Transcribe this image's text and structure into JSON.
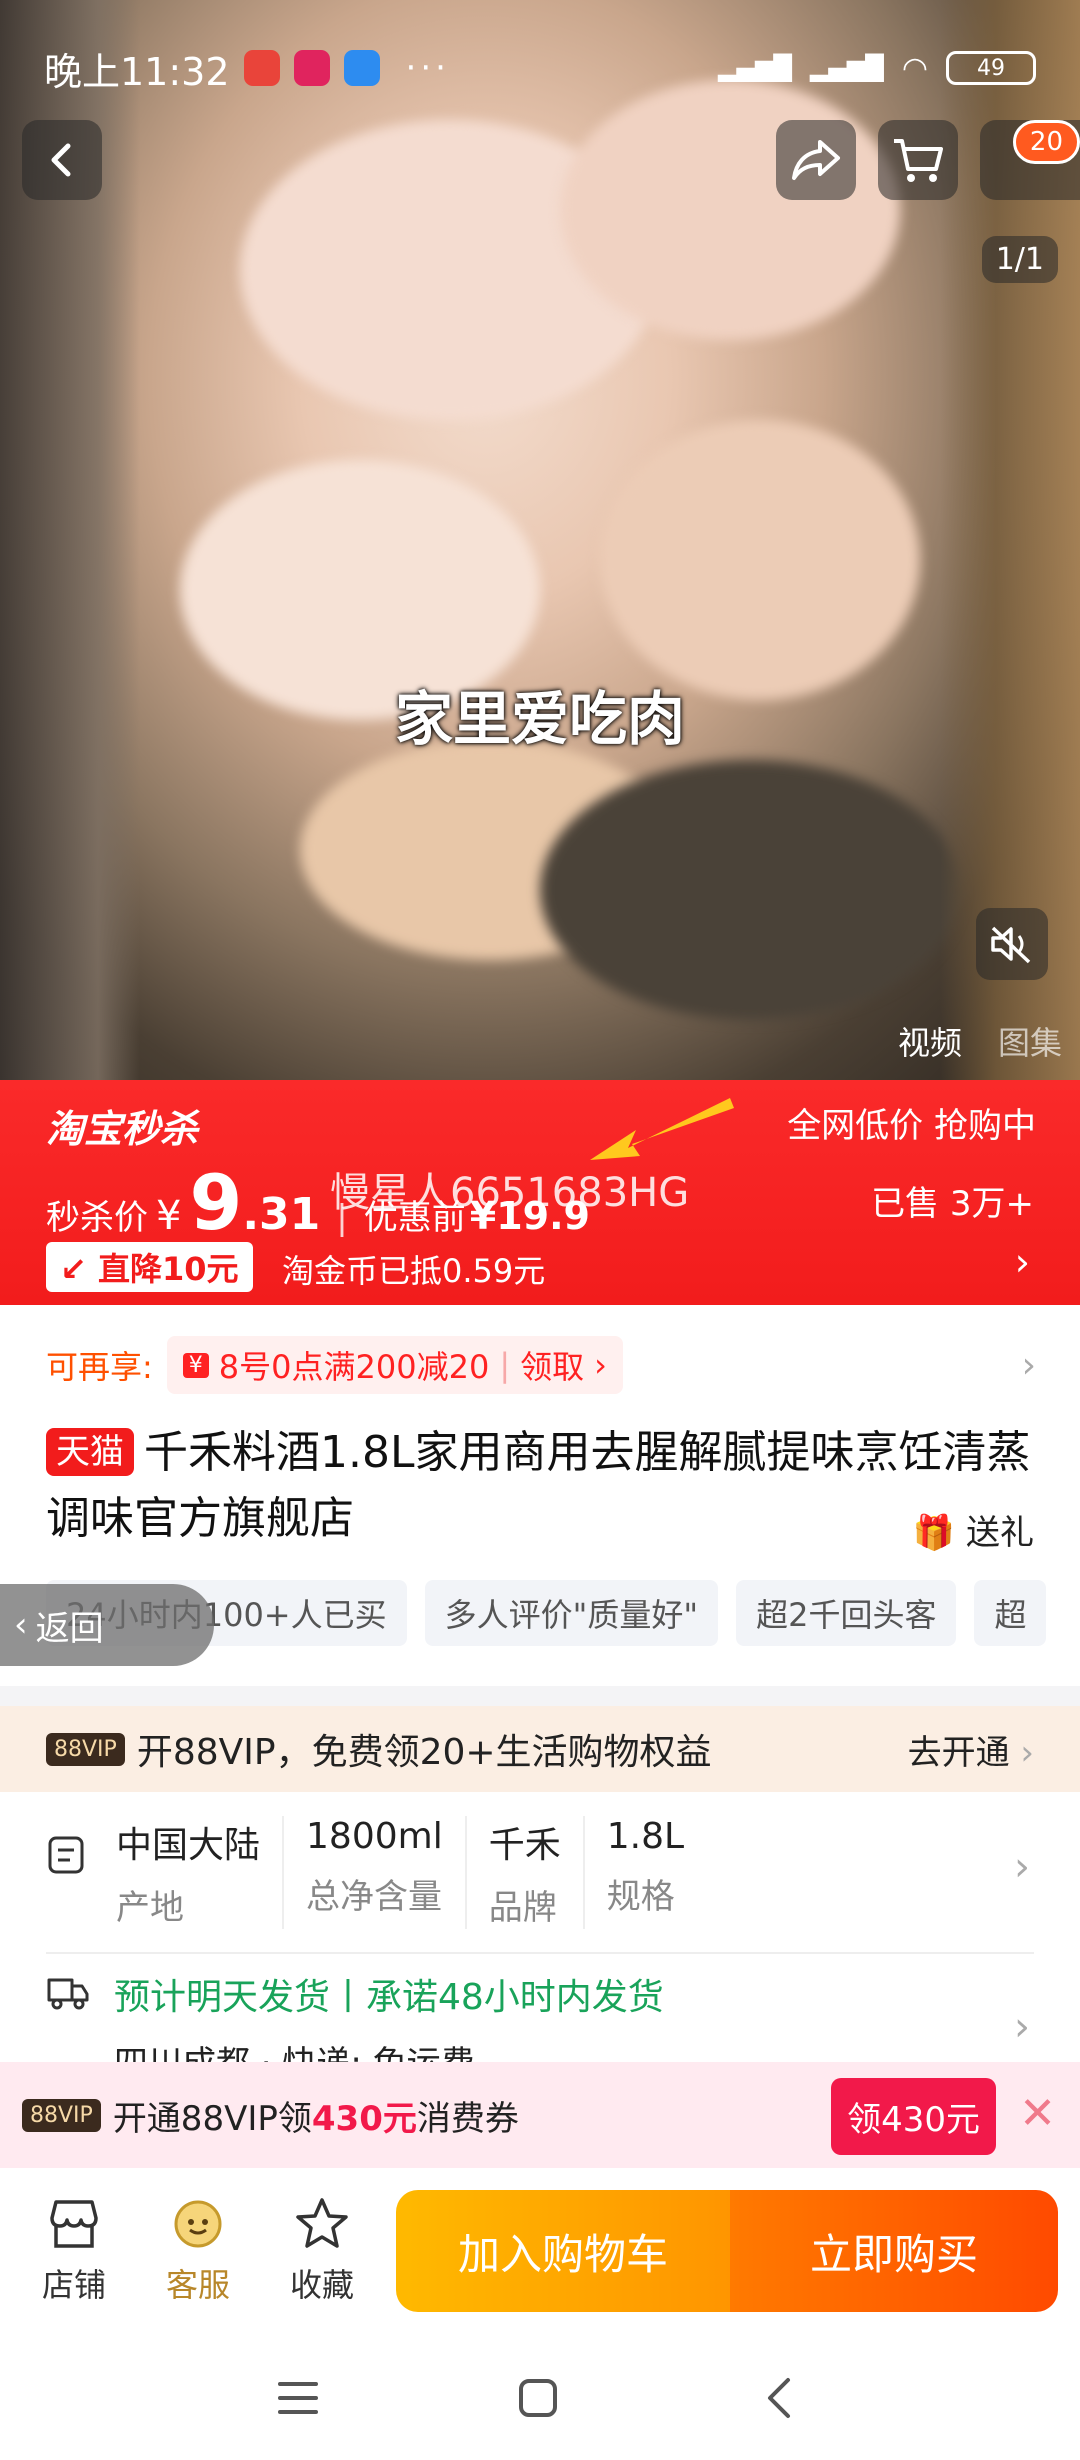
{
  "status_bar": {
    "time": "晚上11:32",
    "battery": "49",
    "more": "···"
  },
  "media": {
    "subtitle": "家里爱吃肉",
    "page_indicator": "1/1",
    "cart_badge": "20",
    "tabs": [
      "视频",
      "图集"
    ]
  },
  "flash_sale": {
    "brand": "淘宝秒杀",
    "tagline": "全网低价 抢购中",
    "price_label": "秒杀价",
    "currency": "¥",
    "price_int": "9",
    "price_dec": ".31",
    "original_label": "优惠前",
    "original_price": "¥19.9",
    "watermark": "慢星人6651683HG",
    "sold": "已售 3万+",
    "drop_badge": "直降10元",
    "coin_note": "淘金币已抵0.59元"
  },
  "coupon": {
    "label": "可再享:",
    "chip_text": "8号0点满200减20",
    "chip_action": "领取"
  },
  "product": {
    "store_tag": "天猫",
    "title": "千禾料酒1.8L家用商用去腥解腻提味烹饪清蒸调味官方旗舰店",
    "gift": "送礼"
  },
  "highlight_chips": [
    "24小时内100+人已买",
    "多人评价\"质量好\"",
    "超2千回头客",
    "超"
  ],
  "back_pill": "返回",
  "vip_row": {
    "logo": "88VIP",
    "text": "开88VIP，免费领20+生活购物权益",
    "action": "去开通"
  },
  "specs": [
    {
      "value": "中国大陆",
      "label": "产地"
    },
    {
      "value": "1800ml",
      "label": "总净含量"
    },
    {
      "value": "千禾",
      "label": "品牌"
    },
    {
      "value": "1.8L",
      "label": "规格"
    }
  ],
  "shipping": {
    "promise": "预计明天发货丨承诺48小时内发货",
    "address": "四川成都 · 快递: 免运费"
  },
  "vip_banner": {
    "logo": "88VIP",
    "prefix": "开通88VIP领",
    "amount": "430元",
    "suffix": "消费券",
    "claim": "领430元"
  },
  "bottom_bar": {
    "store": "店铺",
    "service": "客服",
    "favorite": "收藏",
    "add_cart": "加入购物车",
    "buy_now": "立即购买"
  },
  "colors": {
    "flash_red": "#f21c1c",
    "accent_orange": "#ff5000",
    "ship_green": "#19a35a",
    "vip_pink": "#f2194a"
  }
}
